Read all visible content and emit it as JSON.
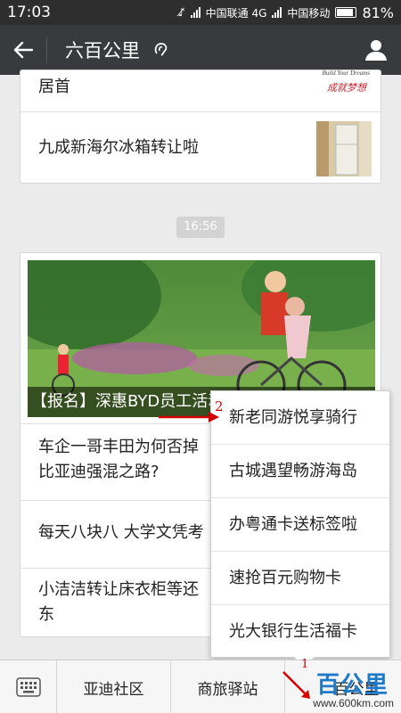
{
  "status_bar": {
    "time": "17:03",
    "carrier1": "中国联通 4G",
    "carrier2": "中国移动",
    "battery": "81%"
  },
  "title_bar": {
    "title": "六百公里"
  },
  "chat": {
    "card1": {
      "row1": "居首",
      "row1_stamp": "成就梦想",
      "row1_stamp_en": "Build Your Dreams",
      "row2": "九成新海尔冰箱转让啦"
    },
    "timestamp": "16:56",
    "card2": {
      "cover_caption": "【报名】深惠BYD员工活动 六送宗松小姐",
      "rows": [
        {
          "line1": "车企一哥丰田为何否掉",
          "line2": "比亚迪强混之路?"
        },
        {
          "line1": "每天八块八 大学文凭考"
        },
        {
          "line1": "小洁洁转让床衣柜等还",
          "line2": "东"
        }
      ]
    }
  },
  "popup_menu": {
    "items": [
      "新老同游悦享骑行",
      "古城遇望畅游海岛",
      "办粤通卡送标签啦",
      "速抢百元购物卡",
      "光大银行生活福卡"
    ]
  },
  "bottom_bar": {
    "menus": [
      "亚迪社区",
      "商旅驿站",
      "百公里"
    ]
  },
  "annotations": {
    "num1": "1",
    "num2": "2"
  },
  "watermark": {
    "logo_text": "百公里",
    "url": "www.600km.com"
  },
  "colors": {
    "title_bar_bg": "#393a3e",
    "status_bar_bg": "#2e2e2e",
    "annotation_red": "#d40000"
  }
}
